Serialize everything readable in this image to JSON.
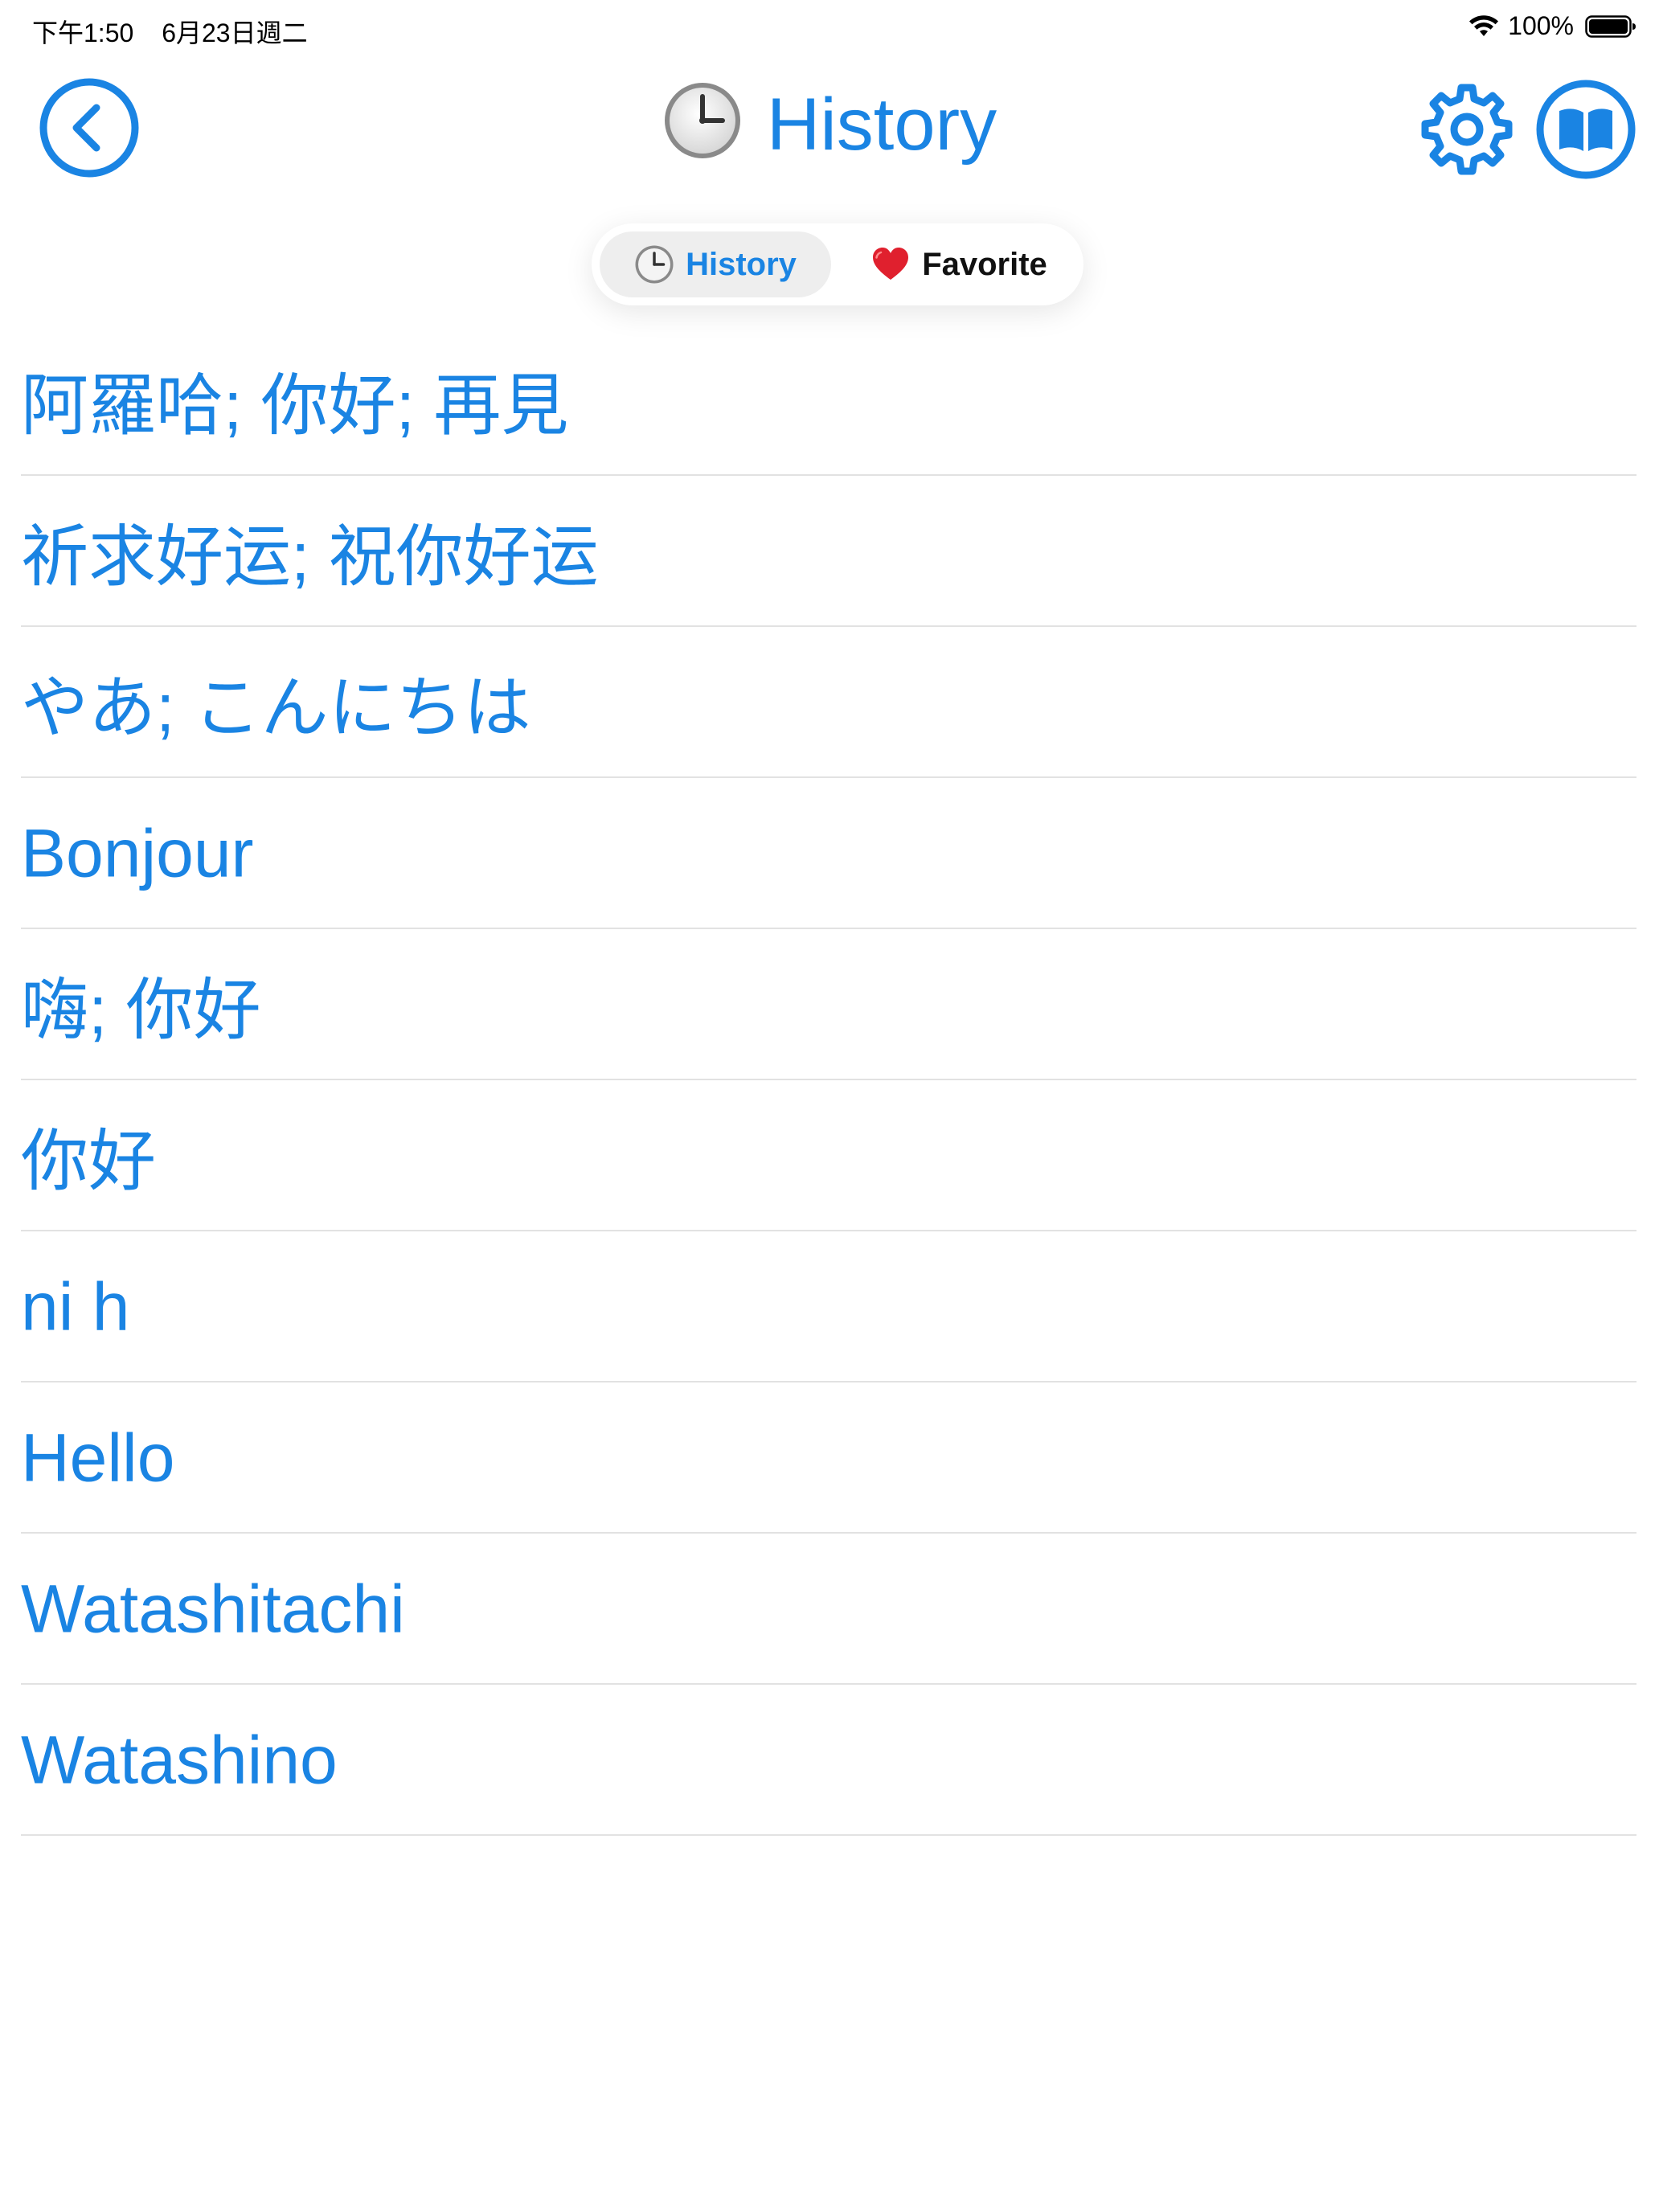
{
  "status_bar": {
    "time": "下午1:50",
    "date": "6月23日週二",
    "battery_percent": "100%",
    "battery_level": 1.0,
    "icons": [
      "wifi-icon",
      "battery-icon"
    ]
  },
  "nav": {
    "title": "History",
    "title_icon": "clock-icon",
    "back_icon": "chevron-left-circle-icon",
    "settings_icon": "gear-icon",
    "book_icon": "book-icon"
  },
  "segments": {
    "history_label": "History",
    "favorite_label": "Favorite",
    "history_icon": "clock-icon",
    "favorite_icon": "heart-icon",
    "selected": "History"
  },
  "history_items": [
    "阿羅哈; 你好; 再見",
    "祈求好运; 祝你好运",
    "やあ; こんにちは",
    "Bonjour",
    "嗨; 你好",
    "你好",
    "ni h",
    "Hello",
    "Watashitachi",
    "Watashino"
  ],
  "colors": {
    "accent": "#1a84e3",
    "divider": "#e2e2e2",
    "segment_selected_bg": "#eeeeee",
    "heart": "#e0202e"
  }
}
